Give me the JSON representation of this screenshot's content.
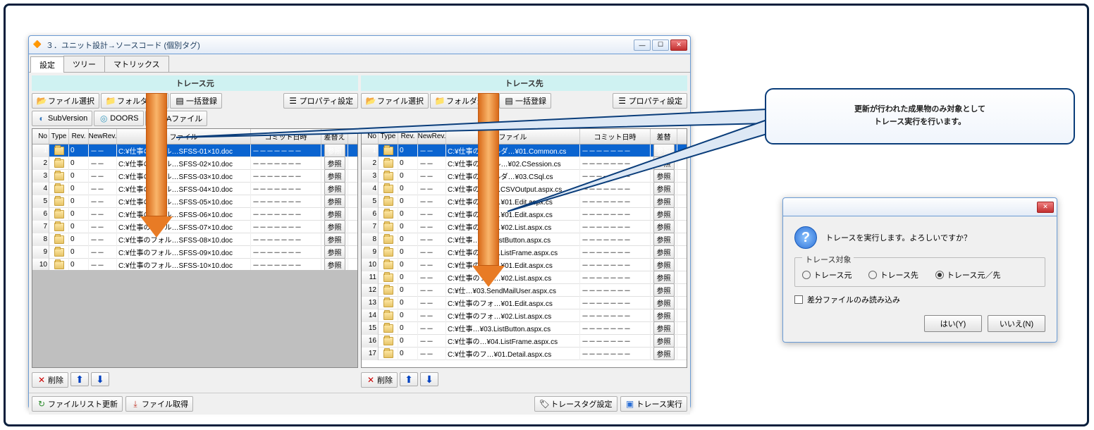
{
  "window": {
    "title": "３．ユニット設計→ソースコード (個別タグ)",
    "tabs": [
      "設定",
      "ツリー",
      "マトリックス"
    ],
    "active_tab": 0
  },
  "left_panel": {
    "title": "トレース元",
    "toolbar1": {
      "file_select": "ファイル選択",
      "folder_select": "フォルダ選択",
      "bulk": "一括登録",
      "prop": "プロパティ設定"
    },
    "toolbar2": {
      "subversion": "SubVersion",
      "doors": "DOORS",
      "ea": "EAファイル"
    },
    "columns": [
      "No",
      "Type",
      "Rev.",
      "NewRev.",
      "ファイル",
      "コミット日時",
      "差替え"
    ],
    "rows": [
      {
        "no": 1,
        "rev": "0",
        "newrev": "－－",
        "file": "C:¥仕事のフォル…SFSS-01×10.doc",
        "commit": "－－－－－－－",
        "ref": "参照",
        "sel": true
      },
      {
        "no": 2,
        "rev": "0",
        "newrev": "－－",
        "file": "C:¥仕事のフォル…SFSS-02×10.doc",
        "commit": "－－－－－－－",
        "ref": "参照"
      },
      {
        "no": 3,
        "rev": "0",
        "newrev": "－－",
        "file": "C:¥仕事のフォル…SFSS-03×10.doc",
        "commit": "－－－－－－－",
        "ref": "参照"
      },
      {
        "no": 4,
        "rev": "0",
        "newrev": "－－",
        "file": "C:¥仕事のフォル…SFSS-04×10.doc",
        "commit": "－－－－－－－",
        "ref": "参照"
      },
      {
        "no": 5,
        "rev": "0",
        "newrev": "－－",
        "file": "C:¥仕事のフォル…SFSS-05×10.doc",
        "commit": "－－－－－－－",
        "ref": "参照"
      },
      {
        "no": 6,
        "rev": "0",
        "newrev": "－－",
        "file": "C:¥仕事のフォル…SFSS-06×10.doc",
        "commit": "－－－－－－－",
        "ref": "参照"
      },
      {
        "no": 7,
        "rev": "0",
        "newrev": "－－",
        "file": "C:¥仕事のフォル…SFSS-07×10.doc",
        "commit": "－－－－－－－",
        "ref": "参照"
      },
      {
        "no": 8,
        "rev": "0",
        "newrev": "－－",
        "file": "C:¥仕事のフォル…SFSS-08×10.doc",
        "commit": "－－－－－－－",
        "ref": "参照"
      },
      {
        "no": 9,
        "rev": "0",
        "newrev": "－－",
        "file": "C:¥仕事のフォル…SFSS-09×10.doc",
        "commit": "－－－－－－－",
        "ref": "参照"
      },
      {
        "no": 10,
        "rev": "0",
        "newrev": "－－",
        "file": "C:¥仕事のフォル…SFSS-10×10.doc",
        "commit": "－－－－－－－",
        "ref": "参照"
      }
    ],
    "bottom": {
      "delete": "削除"
    }
  },
  "right_panel": {
    "title": "トレース先",
    "toolbar1": {
      "file_select": "ファイル選択",
      "folder_select": "フォルダ選択",
      "bulk": "一括登録",
      "prop": "プロパティ設定"
    },
    "columns": [
      "No",
      "Type",
      "Rev.",
      "NewRev.",
      "ファイル",
      "コミット日時",
      "差替"
    ],
    "rows": [
      {
        "no": 1,
        "rev": "0",
        "newrev": "－－",
        "file": "C:¥仕事のフォルダ…¥01.Common.cs",
        "commit": "－－－－－－－",
        "ref": "参照",
        "sel": true
      },
      {
        "no": 2,
        "rev": "0",
        "newrev": "－－",
        "file": "C:¥仕事のフォル…¥02.CSession.cs",
        "commit": "－－－－－－－",
        "ref": "参照"
      },
      {
        "no": 3,
        "rev": "0",
        "newrev": "－－",
        "file": "C:¥仕事のフォルダ…¥03.CSql.cs",
        "commit": "－－－－－－－",
        "ref": "参照"
      },
      {
        "no": 4,
        "rev": "0",
        "newrev": "－－",
        "file": "C:¥仕事の…¥04.CSVOutput.aspx.cs",
        "commit": "－－－－－－－",
        "ref": "参照"
      },
      {
        "no": 5,
        "rev": "0",
        "newrev": "－－",
        "file": "C:¥仕事のフォ…¥01.Edit.aspx.cs",
        "commit": "－－－－－－－",
        "ref": "参照"
      },
      {
        "no": 6,
        "rev": "0",
        "newrev": "－－",
        "file": "C:¥仕事のフォ…¥01.Edit.aspx.cs",
        "commit": "－－－－－－－",
        "ref": "参照"
      },
      {
        "no": 7,
        "rev": "0",
        "newrev": "－－",
        "file": "C:¥仕事のフォ…¥02.List.aspx.cs",
        "commit": "－－－－－－－",
        "ref": "参照"
      },
      {
        "no": 8,
        "rev": "0",
        "newrev": "－－",
        "file": "C:¥仕事…¥03.ListButton.aspx.cs",
        "commit": "－－－－－－－",
        "ref": "参照"
      },
      {
        "no": 9,
        "rev": "0",
        "newrev": "－－",
        "file": "C:¥仕事の…¥04.ListFrame.aspx.cs",
        "commit": "－－－－－－－",
        "ref": "参照"
      },
      {
        "no": 10,
        "rev": "0",
        "newrev": "－－",
        "file": "C:¥仕事のフォ…¥01.Edit.aspx.cs",
        "commit": "－－－－－－－",
        "ref": "参照"
      },
      {
        "no": 11,
        "rev": "0",
        "newrev": "－－",
        "file": "C:¥仕事のフォ…¥02.List.aspx.cs",
        "commit": "－－－－－－－",
        "ref": "参照"
      },
      {
        "no": 12,
        "rev": "0",
        "newrev": "－－",
        "file": "C:¥仕…¥03.SendMailUser.aspx.cs",
        "commit": "－－－－－－－",
        "ref": "参照"
      },
      {
        "no": 13,
        "rev": "0",
        "newrev": "－－",
        "file": "C:¥仕事のフォ…¥01.Edit.aspx.cs",
        "commit": "－－－－－－－",
        "ref": "参照"
      },
      {
        "no": 14,
        "rev": "0",
        "newrev": "－－",
        "file": "C:¥仕事のフォ…¥02.List.aspx.cs",
        "commit": "－－－－－－－",
        "ref": "参照"
      },
      {
        "no": 15,
        "rev": "0",
        "newrev": "－－",
        "file": "C:¥仕事…¥03.ListButton.aspx.cs",
        "commit": "－－－－－－－",
        "ref": "参照"
      },
      {
        "no": 16,
        "rev": "0",
        "newrev": "－－",
        "file": "C:¥仕事の…¥04.ListFrame.aspx.cs",
        "commit": "－－－－－－－",
        "ref": "参照"
      },
      {
        "no": 17,
        "rev": "0",
        "newrev": "－－",
        "file": "C:¥仕事のフ…¥01.Detail.aspx.cs",
        "commit": "－－－－－－－",
        "ref": "参照"
      }
    ],
    "bottom": {
      "delete": "削除"
    }
  },
  "footer": {
    "update_list": "ファイルリスト更新",
    "fetch_file": "ファイル取得",
    "tag_settings": "トレースタグ設定",
    "trace_exec": "トレース実行"
  },
  "callout": "更新が行われた成果物のみ対象として\nトレース実行を行います。",
  "dialog": {
    "message": "トレースを実行します。よろしいですか？",
    "group_label": "トレース対象",
    "radios": [
      "トレース元",
      "トレース先",
      "トレース元／先"
    ],
    "checked": 2,
    "checkbox": "差分ファイルのみ読み込み",
    "yes": "はい(Y)",
    "no": "いいえ(N)"
  }
}
